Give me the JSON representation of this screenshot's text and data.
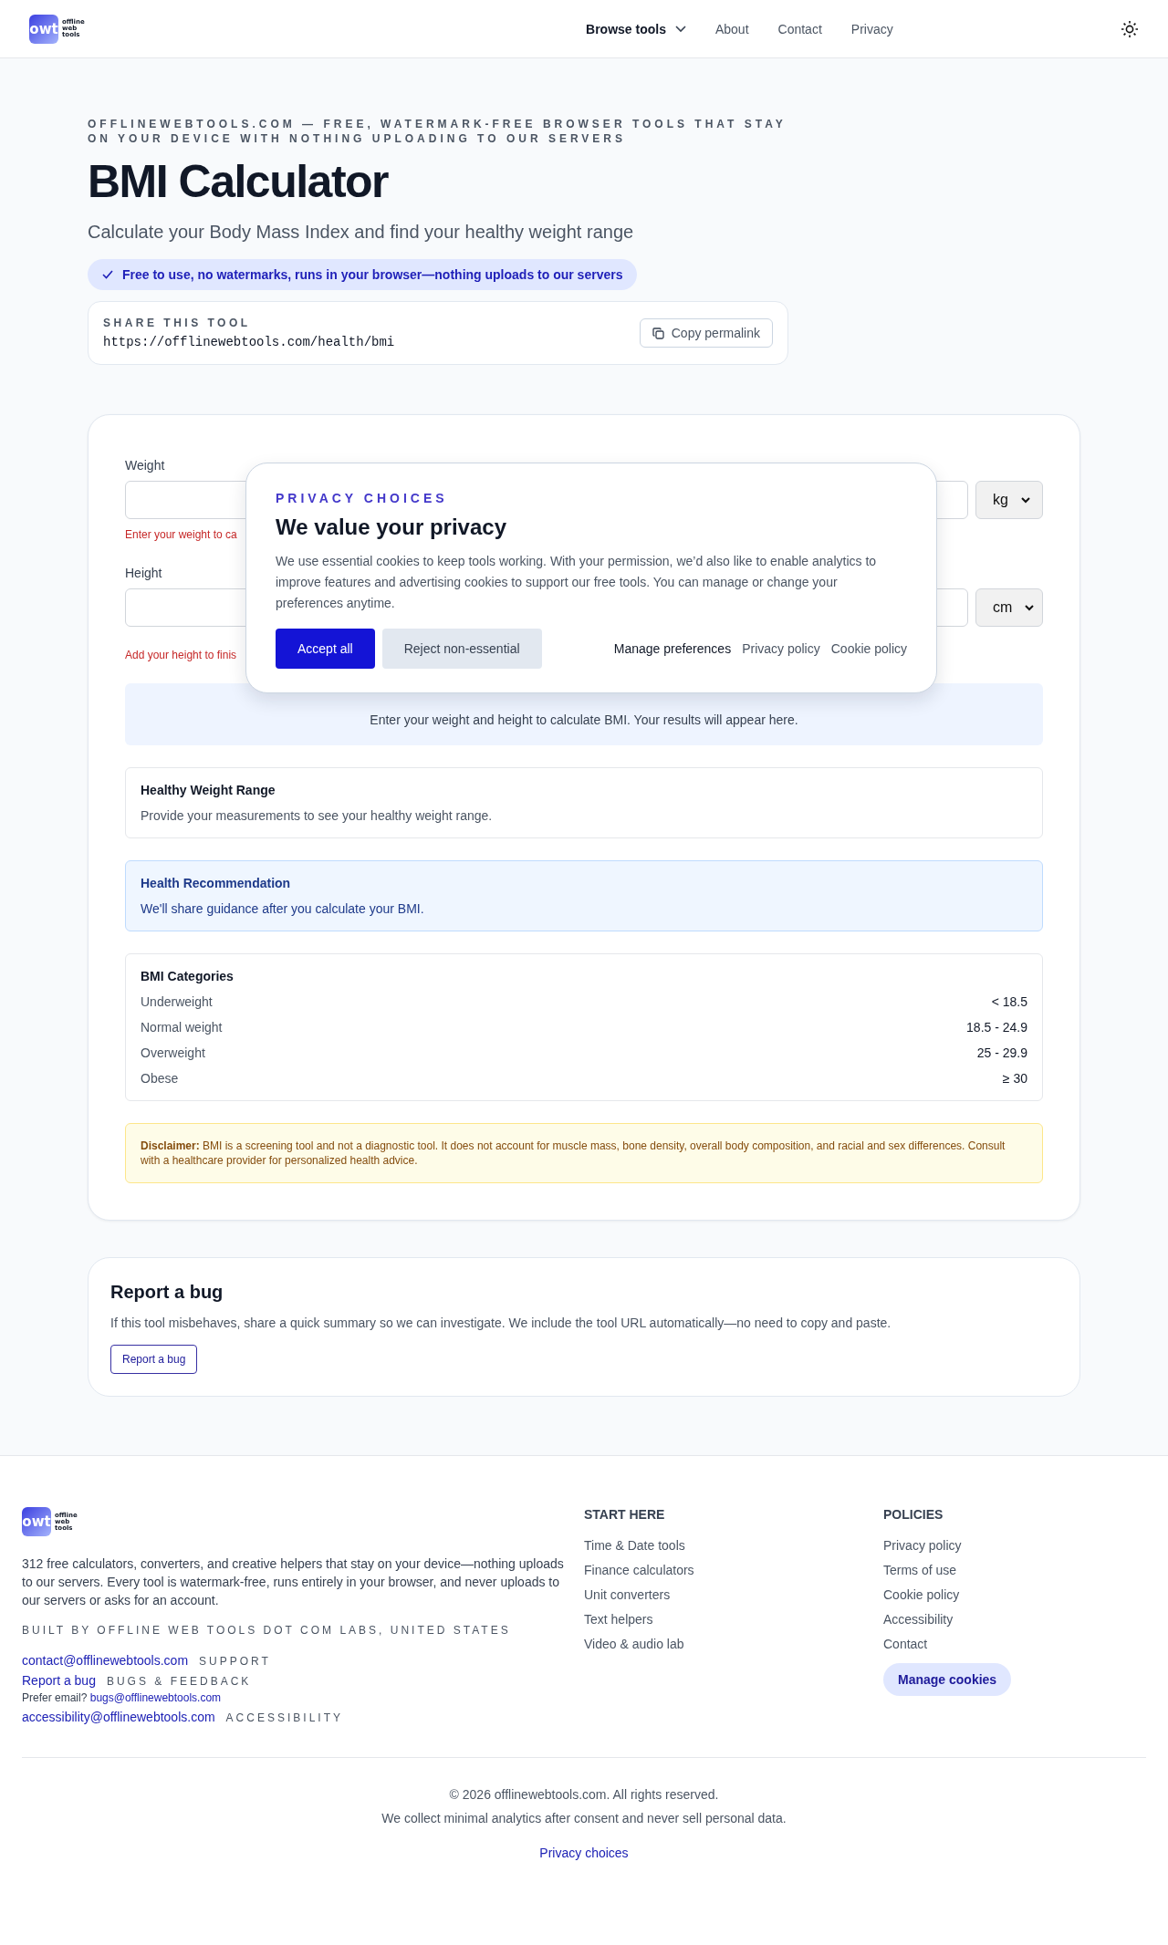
{
  "header": {
    "logo": {
      "mark": "owt",
      "words": [
        "offline",
        "web",
        "tools"
      ]
    },
    "nav": [
      {
        "label": "Browse tools",
        "kind": "menu"
      },
      {
        "label": "About",
        "kind": "link"
      },
      {
        "label": "Contact",
        "kind": "link"
      },
      {
        "label": "Privacy",
        "kind": "link"
      }
    ]
  },
  "hero": {
    "eyebrow": "OFFLINEWEBTOOLS.COM — FREE, WATERMARK-FREE BROWSER TOOLS THAT STAY ON YOUR DEVICE WITH NOTHING UPLOADING TO OUR SERVERS",
    "title": "BMI Calculator",
    "subtitle": "Calculate your Body Mass Index and find your healthy weight range",
    "badge": "Free to use, no watermarks, runs in your browser—nothing uploads to our servers",
    "share": {
      "label": "SHARE THIS TOOL",
      "url": "https://offlinewebtools.com/health/bmi",
      "button": "Copy permalink"
    }
  },
  "calculator": {
    "fields": [
      {
        "label": "Weight",
        "unit": "kg",
        "error": "Enter your weight to ca"
      },
      {
        "label": "Height",
        "unit": "cm",
        "error": "Add your height to finis"
      }
    ],
    "result": "Enter your weight and height to calculate BMI. Your results will appear here.",
    "healthy": {
      "title": "Healthy Weight Range",
      "text": "Provide your measurements to see your healthy weight range."
    },
    "recommendation": {
      "title": "Health Recommendation",
      "text": "We'll share guidance after you calculate your BMI."
    },
    "categories": {
      "title": "BMI Categories",
      "rows": [
        {
          "name": "Underweight",
          "range": "< 18.5"
        },
        {
          "name": "Normal weight",
          "range": "18.5 - 24.9"
        },
        {
          "name": "Overweight",
          "range": "25 - 29.9"
        },
        {
          "name": "Obese",
          "range": "≥ 30"
        }
      ]
    },
    "disclaimer": "**Disclaimer:** BMI is a screening tool and not a diagnostic tool. It does not account for muscle mass, bone density, overall body composition, and racial and sex differences. Consult with a healthcare provider for personalized health advice."
  },
  "privacy_dialog": {
    "eyebrow": "PRIVACY CHOICES",
    "title": "We value your privacy",
    "text": "We use essential cookies to keep tools working. With your permission, we’d also like to enable analytics to improve features and advertising cookies to support our free tools. You can manage or change your preferences anytime.",
    "buttons": [
      {
        "label": "Accept all",
        "kind": "primary"
      },
      {
        "label": "Reject non-essential",
        "kind": "secondary"
      }
    ],
    "links": [
      {
        "label": "Manage preferences",
        "kind": "strong"
      },
      {
        "label": "Privacy policy",
        "kind": "plain"
      },
      {
        "label": "Cookie policy",
        "kind": "plain"
      }
    ]
  },
  "report": {
    "title": "Report a bug",
    "text": "If this tool misbehaves, share a quick summary so we can investigate. We include the tool URL automatically—no need to copy and paste.",
    "button": "Report a bug"
  },
  "footer": {
    "logo": {
      "mark": "owt",
      "words": [
        "offline",
        "web",
        "tools"
      ]
    },
    "about": "312 free calculators, converters, and creative helpers that stay on your device—nothing uploads to our servers. Every tool is watermark-free, runs entirely in your browser, and never uploads to our servers or asks for an account.",
    "built_by": "BUILT BY OFFLINE WEB TOOLS DOT COM LABS, UNITED STATES",
    "contacts": [
      {
        "link": "contact@offlinewebtools.com",
        "tag": "SUPPORT"
      },
      {
        "link": "Report a bug",
        "tag": "BUGS & FEEDBACK",
        "note": "Prefer email?",
        "note_link": "bugs@offlinewebtools.com"
      },
      {
        "link": "accessibility@offlinewebtools.com",
        "tag": "ACCESSIBILITY"
      }
    ],
    "columns": [
      {
        "title": "START HERE",
        "links": [
          "Time & Date tools",
          "Finance calculators",
          "Unit converters",
          "Text helpers",
          "Video & audio lab"
        ]
      },
      {
        "title": "POLICIES",
        "links": [
          "Privacy policy",
          "Terms of use",
          "Cookie policy",
          "Accessibility",
          "Contact"
        ],
        "button": "Manage cookies"
      }
    ],
    "copyright": "© 2026 offlinewebtools.com. All rights reserved.",
    "analytics": "We collect minimal analytics after consent and never sell personal data.",
    "privacy_link": "Privacy choices"
  }
}
